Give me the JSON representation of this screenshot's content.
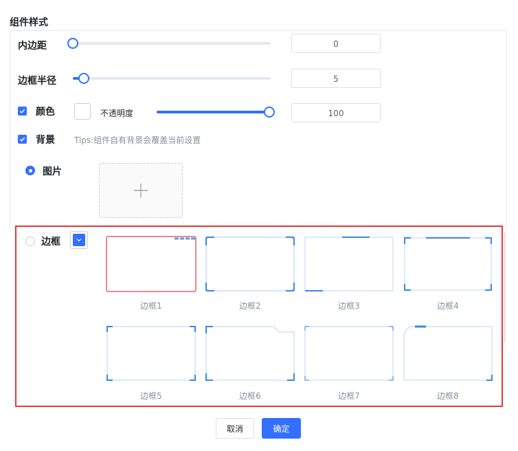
{
  "section_title": "组件样式",
  "padding": {
    "label": "内边距",
    "value": "0",
    "slider_fraction": 0.0
  },
  "border_radius": {
    "label": "边框半径",
    "value": "5",
    "slider_fraction": 0.05
  },
  "color": {
    "label": "颜色",
    "checked": true,
    "opacity_label": "不透明度",
    "opacity_value": "100",
    "slider_fraction": 1.0
  },
  "background": {
    "label": "背景",
    "checked": true,
    "tips": "Tips:组件自有背景会覆盖当前设置"
  },
  "image_option": {
    "label": "图片",
    "selected": true,
    "upload_icon": "plus-icon"
  },
  "border_option": {
    "label": "边框",
    "selected": false,
    "dropdown_icon": "chevron-down-icon"
  },
  "frames": [
    {
      "label": "边框1",
      "selected": true
    },
    {
      "label": "边框2",
      "selected": false
    },
    {
      "label": "边框3",
      "selected": false
    },
    {
      "label": "边框4",
      "selected": false
    },
    {
      "label": "边框5",
      "selected": false
    },
    {
      "label": "边框6",
      "selected": false
    },
    {
      "label": "边框7",
      "selected": false
    },
    {
      "label": "边框8",
      "selected": false
    }
  ],
  "buttons": {
    "cancel": "取消",
    "ok": "确定"
  },
  "colors": {
    "accent": "#3370ff",
    "highlight_border": "#e53935",
    "frame_line": "#7fb2f0"
  }
}
